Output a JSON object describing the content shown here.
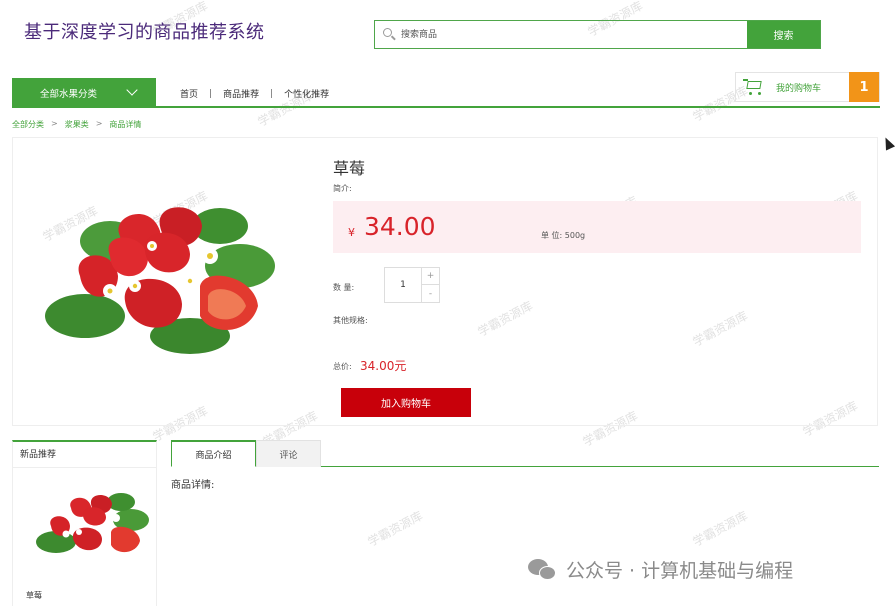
{
  "header": {
    "site_title": "基于深度学习的商品推荐系统",
    "search_placeholder": "搜索商品",
    "search_button": "搜索"
  },
  "nav": {
    "category_button": "全部水果分类",
    "links": [
      "首页",
      "商品推荐",
      "个性化推荐"
    ],
    "cart_label": "我的购物车",
    "cart_count": "1"
  },
  "breadcrumb": [
    "全部分类",
    "浆果类",
    "商品详情"
  ],
  "product": {
    "name": "草莓",
    "intro_label": "简介:",
    "currency": "¥",
    "price": "34.00",
    "unit": "单 位:  500g",
    "qty_label": "数 量:",
    "qty_value": "1",
    "qty_plus": "+",
    "qty_minus": "-",
    "other_spec": "其他规格:",
    "total_label": "总价:",
    "total_value": "34.00元",
    "add_to_cart": "加入购物车"
  },
  "sidebar": {
    "title": "新品推荐",
    "items": [
      {
        "name": "草莓"
      }
    ]
  },
  "tabs": {
    "intro": "商品介绍",
    "review": "评论",
    "detail_title": "商品详情:"
  },
  "footer_watermark": "公众号 · 计算机基础与编程",
  "watermark_text": "学霸资源库",
  "colors": {
    "brand_green": "#43a33b",
    "price_red": "#d8232a",
    "cart_orange": "#f29418",
    "button_red": "#c8000a",
    "title_purple": "#4b2a7a"
  }
}
